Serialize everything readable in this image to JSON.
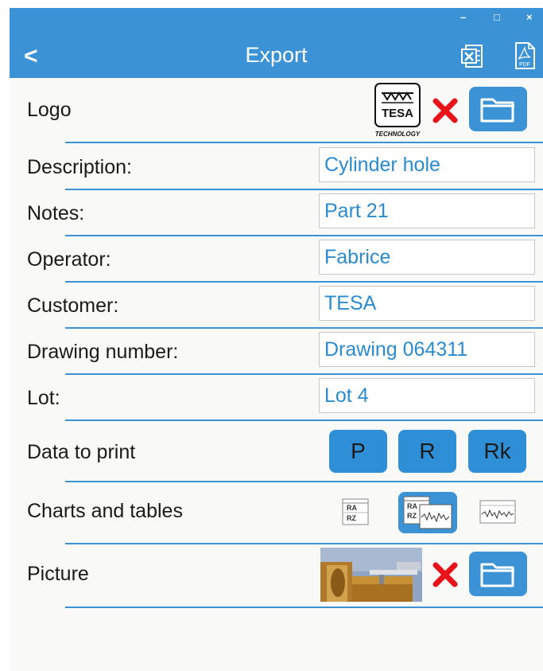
{
  "window": {
    "minimize": "–",
    "maximize": "□",
    "close": "×"
  },
  "header": {
    "back": "<",
    "title": "Export"
  },
  "logo": {
    "label": "Logo",
    "brand_top": "TESA",
    "brand_bottom": "TECHNOLOGY"
  },
  "fields": [
    {
      "label": "Description:",
      "value": "Cylinder hole"
    },
    {
      "label": "Notes:",
      "value": "Part 21"
    },
    {
      "label": "Operator:",
      "value": "Fabrice"
    },
    {
      "label": "Customer:",
      "value": "TESA"
    },
    {
      "label": "Drawing number:",
      "value": "Drawing 064311"
    },
    {
      "label": "Lot:",
      "value": "Lot 4"
    }
  ],
  "data_to_print": {
    "label": "Data to print",
    "options": [
      "P",
      "R",
      "Rk"
    ]
  },
  "charts_tables": {
    "label": "Charts and tables",
    "table_text": [
      "RA",
      "RZ"
    ]
  },
  "picture": {
    "label": "Picture"
  },
  "colors": {
    "accent": "#3b93d6",
    "value_text": "#2a8bd0",
    "delete": "#e8141c"
  }
}
